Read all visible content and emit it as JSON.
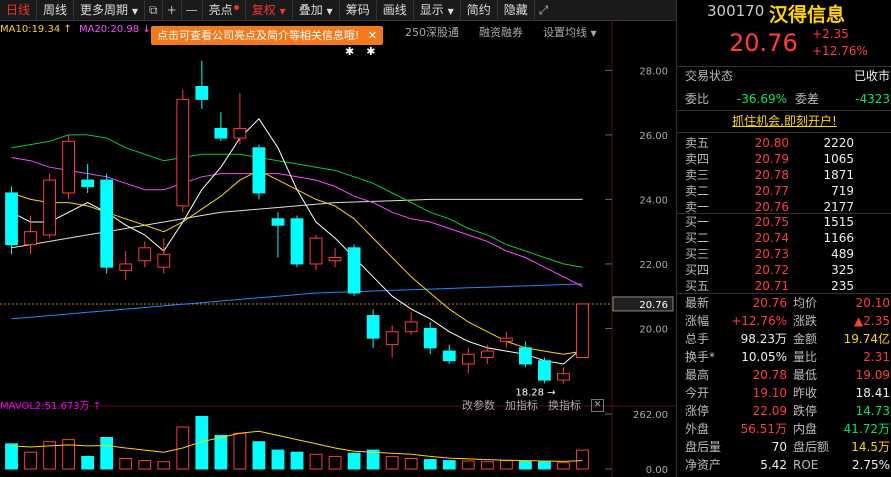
{
  "toolbar": {
    "items": [
      "日线",
      "周线",
      "更多周期",
      "亮点",
      "复权",
      "叠加",
      "筹码",
      "画线",
      "显示",
      "简约",
      "隐藏"
    ],
    "icons": [
      "fullscreen-icon",
      "plus-icon",
      "minus-icon"
    ]
  },
  "legend": {
    "ma10": "MA10:19.34",
    "ma20": "MA20:20.98",
    "tabs": [
      "250深股通",
      "融资融券",
      "设置均线"
    ]
  },
  "tooltip": "点击可查看公司亮点及简介等相关信息哦!",
  "axis": {
    "price_ticks": [
      "28.00",
      "26.00",
      "24.00",
      "22.00",
      "20.00"
    ],
    "current_price_tag": "20.76",
    "vol_ticks": [
      "262.00",
      "0.00"
    ],
    "low_marker": "18.28"
  },
  "volume": {
    "legend": "MAVOL2:51.673万",
    "tools": [
      "改参数",
      "加指标",
      "换指标"
    ]
  },
  "panel": {
    "code": "300170",
    "name": "汉得信息",
    "price": "20.76",
    "change": "+2.35",
    "change_pct": "+12.76%",
    "status_label": "交易状态",
    "status_value": "已收市",
    "weibi_label": "委比",
    "weibi_value": "-36.69%",
    "weicha_label": "委差",
    "weicha_value": "-4323",
    "promo": "抓住机会,即刻开户!",
    "sells": [
      {
        "label": "卖五",
        "price": "20.80",
        "vol": "2220"
      },
      {
        "label": "卖四",
        "price": "20.79",
        "vol": "1065"
      },
      {
        "label": "卖三",
        "price": "20.78",
        "vol": "1871"
      },
      {
        "label": "卖二",
        "price": "20.77",
        "vol": "719"
      },
      {
        "label": "卖一",
        "price": "20.76",
        "vol": "2177"
      }
    ],
    "buys": [
      {
        "label": "买一",
        "price": "20.75",
        "vol": "1515"
      },
      {
        "label": "买二",
        "price": "20.74",
        "vol": "1166"
      },
      {
        "label": "买三",
        "price": "20.73",
        "vol": "489"
      },
      {
        "label": "买四",
        "price": "20.72",
        "vol": "325"
      },
      {
        "label": "买五",
        "price": "20.71",
        "vol": "235"
      }
    ],
    "stats": [
      {
        "l1": "最新",
        "v1": "20.76",
        "c1": "red",
        "l2": "均价",
        "v2": "20.10",
        "c2": "red"
      },
      {
        "l1": "涨幅",
        "v1": "+12.76%",
        "c1": "red",
        "l2": "涨跌",
        "v2": "▲2.35",
        "c2": "red"
      },
      {
        "l1": "总手",
        "v1": "98.23万",
        "c1": "white",
        "l2": "金额",
        "v2": "19.74亿",
        "c2": "yellow"
      },
      {
        "l1": "换手*",
        "v1": "10.05%",
        "c1": "white",
        "l2": "量比",
        "v2": "2.31",
        "c2": "red"
      },
      {
        "l1": "最高",
        "v1": "20.78",
        "c1": "red",
        "l2": "最低",
        "v2": "19.09",
        "c2": "red"
      },
      {
        "l1": "今开",
        "v1": "19.10",
        "c1": "red",
        "l2": "昨收",
        "v2": "18.41",
        "c2": "white"
      },
      {
        "l1": "涨停",
        "v1": "22.09",
        "c1": "red",
        "l2": "跌停",
        "v2": "14.73",
        "c2": "green"
      },
      {
        "l1": "外盘",
        "v1": "56.51万",
        "c1": "red",
        "l2": "内盘",
        "v2": "41.72万",
        "c2": "green"
      },
      {
        "l1": "盘后量",
        "v1": "70",
        "c1": "white",
        "l2": "盘后额",
        "v2": "14.5万",
        "c2": "yellow"
      },
      {
        "l1": "净资产",
        "v1": "5.42",
        "c1": "white",
        "l2": "ROE",
        "v2": "2.75%",
        "c2": "white"
      }
    ]
  },
  "colors": {
    "up": "#ff3b3b",
    "down": "#00ffff",
    "ma5": "#ffffff",
    "ma10": "#ffd400",
    "ma20": "#ff44ff",
    "ma30": "#00cc33",
    "ma60": "#2288ff",
    "ma120": "#dddddd"
  },
  "chart_data": {
    "type": "candlestick",
    "price_ylim": [
      18.0,
      28.6
    ],
    "candles": [
      {
        "o": 24.2,
        "c": 22.6,
        "h": 24.4,
        "l": 22.3
      },
      {
        "o": 22.6,
        "c": 23.0,
        "h": 23.5,
        "l": 22.3
      },
      {
        "o": 22.9,
        "c": 24.6,
        "h": 24.8,
        "l": 22.8
      },
      {
        "o": 24.2,
        "c": 25.8,
        "h": 26.0,
        "l": 24.0
      },
      {
        "o": 24.6,
        "c": 24.4,
        "h": 25.1,
        "l": 24.2
      },
      {
        "o": 24.6,
        "c": 21.9,
        "h": 24.8,
        "l": 21.7
      },
      {
        "o": 21.8,
        "c": 22.0,
        "h": 22.4,
        "l": 21.5
      },
      {
        "o": 22.1,
        "c": 22.5,
        "h": 22.7,
        "l": 21.9
      },
      {
        "o": 21.9,
        "c": 22.3,
        "h": 22.8,
        "l": 21.7
      },
      {
        "o": 23.8,
        "c": 27.1,
        "h": 27.4,
        "l": 23.6
      },
      {
        "o": 27.5,
        "c": 27.1,
        "h": 28.3,
        "l": 26.8
      },
      {
        "o": 26.2,
        "c": 25.9,
        "h": 26.7,
        "l": 25.8
      },
      {
        "o": 25.9,
        "c": 26.2,
        "h": 27.3,
        "l": 25.7
      },
      {
        "o": 25.6,
        "c": 24.2,
        "h": 25.7,
        "l": 24.0
      },
      {
        "o": 23.4,
        "c": 23.2,
        "h": 23.6,
        "l": 22.2
      },
      {
        "o": 23.4,
        "c": 22.0,
        "h": 23.5,
        "l": 21.9
      },
      {
        "o": 22.0,
        "c": 22.8,
        "h": 22.9,
        "l": 21.8
      },
      {
        "o": 22.1,
        "c": 22.2,
        "h": 22.5,
        "l": 21.9
      },
      {
        "o": 22.5,
        "c": 21.1,
        "h": 22.6,
        "l": 21.0
      },
      {
        "o": 20.4,
        "c": 19.7,
        "h": 20.6,
        "l": 19.4
      },
      {
        "o": 19.5,
        "c": 19.9,
        "h": 20.1,
        "l": 19.1
      },
      {
        "o": 19.9,
        "c": 20.2,
        "h": 20.5,
        "l": 19.8
      },
      {
        "o": 20.0,
        "c": 19.4,
        "h": 20.2,
        "l": 19.2
      },
      {
        "o": 19.3,
        "c": 19.0,
        "h": 19.5,
        "l": 18.9
      },
      {
        "o": 18.9,
        "c": 19.2,
        "h": 19.4,
        "l": 18.6
      },
      {
        "o": 19.1,
        "c": 19.3,
        "h": 19.5,
        "l": 18.9
      },
      {
        "o": 19.6,
        "c": 19.7,
        "h": 19.9,
        "l": 19.4
      },
      {
        "o": 19.4,
        "c": 18.9,
        "h": 19.6,
        "l": 18.8
      },
      {
        "o": 19.0,
        "c": 18.4,
        "h": 19.1,
        "l": 18.3
      },
      {
        "o": 18.4,
        "c": 18.6,
        "h": 18.8,
        "l": 18.3
      },
      {
        "o": 19.1,
        "c": 20.76,
        "h": 20.78,
        "l": 19.09
      }
    ],
    "ma5": [
      23.6,
      23.3,
      23.3,
      23.6,
      23.9,
      23.6,
      23.2,
      22.9,
      22.4,
      23.3,
      24.3,
      25.0,
      25.9,
      26.5,
      25.6,
      24.3,
      23.3,
      22.8,
      22.2,
      21.6,
      21.0,
      20.6,
      20.3,
      19.9,
      19.6,
      19.4,
      19.3,
      19.2,
      19.0,
      18.9,
      19.4
    ],
    "ma10": [
      24.2,
      24.0,
      23.9,
      23.9,
      23.8,
      23.6,
      23.4,
      23.2,
      23.0,
      23.3,
      23.7,
      24.1,
      24.6,
      24.9,
      24.6,
      24.3,
      24.0,
      23.8,
      23.4,
      22.8,
      22.2,
      21.6,
      21.1,
      20.6,
      20.2,
      19.9,
      19.6,
      19.4,
      19.3,
      19.2,
      19.3
    ],
    "ma20": [
      25.3,
      25.2,
      25.0,
      24.9,
      24.8,
      24.7,
      24.5,
      24.3,
      24.3,
      24.5,
      24.7,
      24.8,
      24.8,
      24.8,
      24.8,
      24.7,
      24.6,
      24.4,
      24.1,
      23.9,
      23.6,
      23.4,
      23.3,
      23.1,
      22.9,
      22.7,
      22.4,
      22.2,
      21.9,
      21.6,
      21.3
    ],
    "ma30": [
      25.6,
      25.7,
      25.8,
      26.0,
      26.0,
      25.9,
      25.6,
      25.4,
      25.2,
      25.3,
      25.4,
      25.4,
      25.4,
      25.3,
      25.2,
      25.1,
      25.0,
      24.9,
      24.7,
      24.5,
      24.2,
      23.9,
      23.6,
      23.4,
      23.1,
      22.9,
      22.6,
      22.4,
      22.2,
      22.0,
      21.9
    ],
    "ma60": [
      20.3,
      20.35,
      20.4,
      20.45,
      20.5,
      20.55,
      20.6,
      20.65,
      20.7,
      20.75,
      20.8,
      20.85,
      20.9,
      20.95,
      21.0,
      21.05,
      21.1,
      21.12,
      21.14,
      21.16,
      21.18,
      21.2,
      21.22,
      21.24,
      21.26,
      21.28,
      21.3,
      21.32,
      21.34,
      21.36,
      21.38
    ],
    "ma120": [
      22.5,
      22.6,
      22.7,
      22.8,
      22.9,
      23.0,
      23.1,
      23.2,
      23.3,
      23.4,
      23.5,
      23.6,
      23.65,
      23.7,
      23.75,
      23.8,
      23.85,
      23.9,
      23.92,
      23.94,
      23.96,
      23.98,
      24.0,
      24.0,
      24.0,
      24.0,
      24.0,
      24.0,
      24.0,
      24.0,
      24.0
    ],
    "volume_ylim": [
      0,
      262
    ],
    "volume": [
      120,
      80,
      130,
      140,
      60,
      150,
      50,
      40,
      35,
      200,
      250,
      160,
      170,
      130,
      90,
      80,
      70,
      60,
      75,
      90,
      60,
      50,
      45,
      40,
      38,
      35,
      40,
      36,
      34,
      30,
      90
    ],
    "mavol": [
      110,
      105,
      110,
      115,
      110,
      112,
      100,
      90,
      80,
      100,
      130,
      150,
      170,
      180,
      160,
      140,
      120,
      100,
      85,
      80,
      75,
      70,
      60,
      52,
      48,
      45,
      42,
      40,
      38,
      36,
      40
    ]
  }
}
